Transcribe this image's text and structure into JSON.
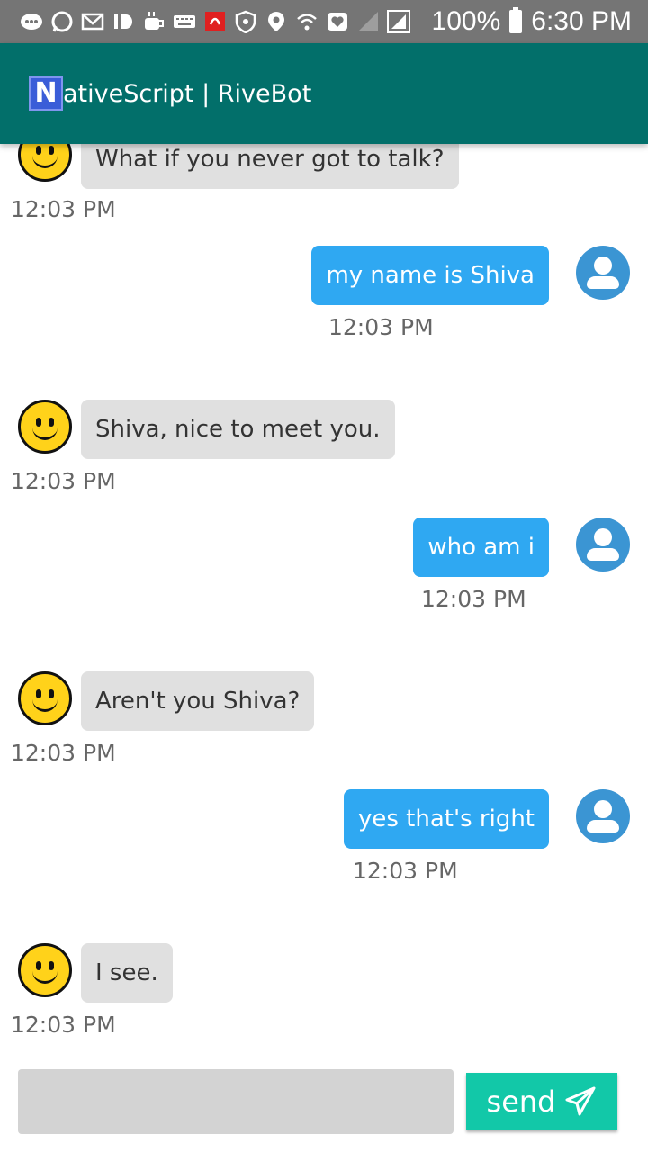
{
  "status_bar": {
    "battery": "100%",
    "time": "6:30 PM",
    "icons": [
      "chat-bubble-icon",
      "whatsapp-icon",
      "gmail-icon",
      "id-icon",
      "coffee-icon",
      "keyboard-icon",
      "airtel-icon",
      "shield-icon",
      "location-icon",
      "wifi-icon",
      "heart-icon",
      "signal-icon",
      "signal-box-icon",
      "battery-icon"
    ]
  },
  "app_bar": {
    "logo_letter": "N",
    "title": "ativeScript | RiveBot"
  },
  "messages": [
    {
      "sender": "bot",
      "text": "What if you never got to talk?",
      "time": "12:03 PM"
    },
    {
      "sender": "user",
      "text": "my name is Shiva",
      "time": "12:03 PM"
    },
    {
      "sender": "bot",
      "text": "Shiva, nice to meet you.",
      "time": "12:03 PM"
    },
    {
      "sender": "user",
      "text": "who am i",
      "time": "12:03 PM"
    },
    {
      "sender": "bot",
      "text": "Aren't you Shiva?",
      "time": "12:03 PM"
    },
    {
      "sender": "user",
      "text": "yes that's right",
      "time": "12:03 PM"
    },
    {
      "sender": "bot",
      "text": "I see.",
      "time": "12:03 PM"
    }
  ],
  "composer": {
    "value": "",
    "send_label": "send"
  },
  "colors": {
    "app_bar": "#026f6a",
    "user_bubble": "#2fa8f2",
    "bot_bubble": "#e0e0e0",
    "send_button": "#12c8a8"
  }
}
